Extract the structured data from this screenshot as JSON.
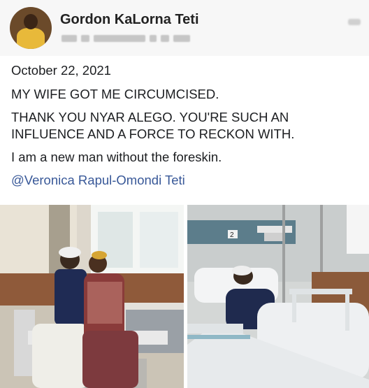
{
  "author": {
    "name": "Gordon KaLorna Teti",
    "avatar_icon": "profile-photo-icon"
  },
  "post": {
    "date": "October 22, 2021",
    "line1": "MY WIFE GOT ME CIRCUMCISED.",
    "line2a": "THANK YOU NYAR ALEGO. YOU'RE SUCH AN",
    "line2b": "INFLUENCE AND A FORCE TO RECKON WITH.",
    "line3": "I am a new man without the foreskin.",
    "mention": "@Veronica Rapul-Omondi Teti"
  },
  "photos": {
    "right_bed_number": "2"
  },
  "colors": {
    "mention": "#385898",
    "header_bg": "#f7f7f7"
  }
}
